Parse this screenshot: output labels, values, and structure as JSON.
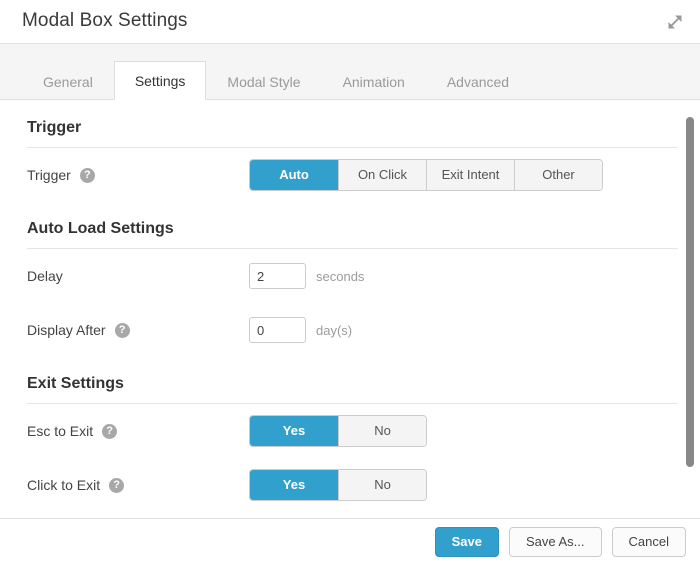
{
  "window": {
    "title": "Modal Box Settings",
    "expand_icon": "expand-diagonal-icon"
  },
  "tabs": [
    {
      "label": "General",
      "active": false
    },
    {
      "label": "Settings",
      "active": true
    },
    {
      "label": "Modal Style",
      "active": false
    },
    {
      "label": "Animation",
      "active": false
    },
    {
      "label": "Advanced",
      "active": false
    }
  ],
  "sections": [
    {
      "heading": "Trigger",
      "rows": [
        {
          "label": "Trigger",
          "help": true,
          "control": "buttongroup",
          "options": [
            "Auto",
            "On Click",
            "Exit Intent",
            "Other"
          ],
          "selected": "Auto"
        }
      ]
    },
    {
      "heading": "Auto Load Settings",
      "rows": [
        {
          "label": "Delay",
          "help": false,
          "control": "number",
          "value": "2",
          "unit": "seconds"
        },
        {
          "label": "Display After",
          "help": true,
          "control": "number",
          "value": "0",
          "unit": "day(s)"
        }
      ]
    },
    {
      "heading": "Exit Settings",
      "rows": [
        {
          "label": "Esc to Exit",
          "help": true,
          "control": "buttongroup",
          "options": [
            "Yes",
            "No"
          ],
          "selected": "Yes"
        },
        {
          "label": "Click to Exit",
          "help": true,
          "control": "buttongroup",
          "options": [
            "Yes",
            "No"
          ],
          "selected": "Yes"
        }
      ]
    }
  ],
  "footer": {
    "save_label": "Save",
    "save_as_label": "Save As...",
    "cancel_label": "Cancel"
  },
  "colors": {
    "accent": "#31a0cd",
    "tabbar_bg": "#f5f5f5",
    "border": "#dddddd",
    "muted_text": "#9a9a9a",
    "scrollbar_thumb": "#888888"
  }
}
